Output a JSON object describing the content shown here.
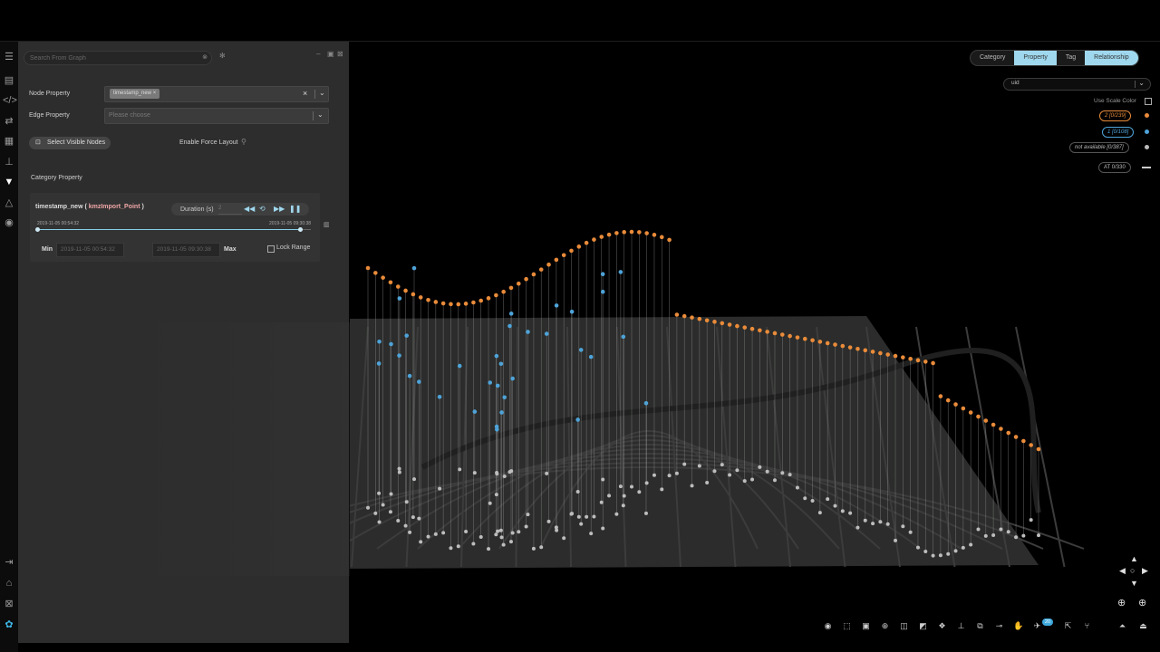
{
  "panel": {
    "search_placeholder": "Search From Graph",
    "node_property_label": "Node Property",
    "node_property_tag": "timestamp_new",
    "edge_property_label": "Edge Property",
    "edge_property_placeholder": "Please choose",
    "select_visible_label": "Select Visible Nodes",
    "force_layout_label": "Enable Force Layout",
    "category_property_label": "Category Property"
  },
  "card": {
    "title_prefix": "timestamp_new ( ",
    "title_schema": "kmzImport_Point",
    "title_suffix": " )",
    "duration_label": "Duration (s)",
    "duration_value": "2",
    "range_start_label": "2019-11-05 00:54:32",
    "range_end_label": "2019-11-05 09:30:38",
    "min_label": "Min",
    "min_value": "2019-11-05 00:54:32",
    "max_value": "2019-11-05 09:30:38",
    "max_label": "Max",
    "lock_range_label": "Lock Range",
    "range_fraction": 0.96
  },
  "right": {
    "tabs": [
      "Category",
      "Property",
      "Tag",
      "Relationship"
    ],
    "active_tabs": [
      "Property",
      "Relationship"
    ],
    "select_value": "uid",
    "use_scale_color_label": "Use Scale Color",
    "legend": [
      {
        "label": "2 [0/239]",
        "color": "#e98b3a"
      },
      {
        "label": "1 [0/108]",
        "color": "#4ea3d8"
      },
      {
        "label": "not available [0/387]",
        "color": "#bbbbbb"
      },
      {
        "label": "AT 0/330",
        "color": "#cccccc"
      }
    ]
  },
  "toolbar": {
    "badge": "20"
  },
  "colors": {
    "orange": "#e98b3a",
    "blue": "#4ea3d8",
    "accent": "#9fd8ee",
    "panel_bg": "#2d2d2d"
  }
}
